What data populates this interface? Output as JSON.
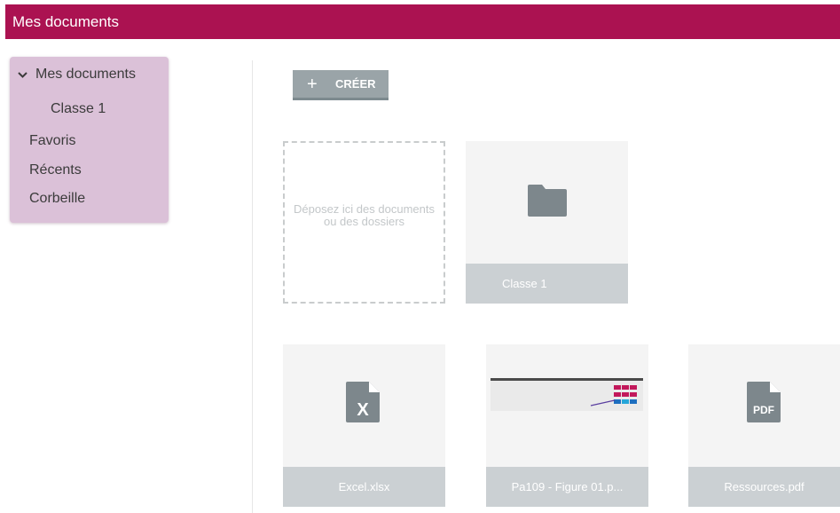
{
  "header": {
    "title": "Mes documents"
  },
  "sidebar": {
    "root": "Mes documents",
    "child": "Classe 1",
    "favorites": "Favoris",
    "recent": "Récents",
    "trash": "Corbeille"
  },
  "toolbar": {
    "create_icon": "+",
    "create_label": "CRÉER"
  },
  "dropzone": {
    "text": "Déposez ici des documents ou des dossiers"
  },
  "items": [
    {
      "name": "Classe 1",
      "icon": "folder-icon"
    },
    {
      "name": "Excel.xlsx",
      "icon": "excel-file-icon"
    },
    {
      "name": "Pa109 - Figure 01.p...",
      "icon": "image-thumbnail"
    },
    {
      "name": "Ressources.pdf",
      "icon": "pdf-file-icon"
    }
  ],
  "icons": {
    "pdf_label": "PDF",
    "excel_label": "X"
  },
  "colors": {
    "brand": "#ab1251",
    "sidebar_bg": "#dbc1d8",
    "button_bg": "#9aa4a8",
    "card_bg": "#f4f4f4",
    "card_footer": "#cbd0d3",
    "icon_gray": "#7d878c"
  }
}
